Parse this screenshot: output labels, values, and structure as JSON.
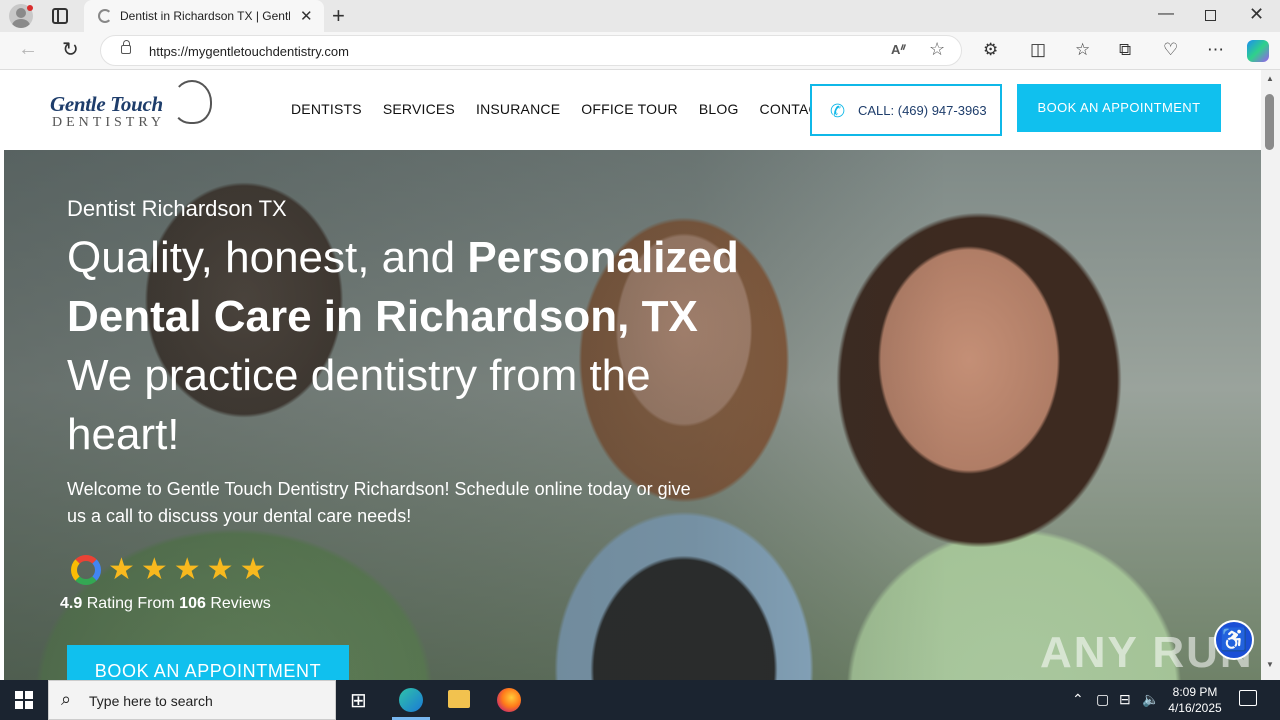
{
  "browser": {
    "tab_title": "Dentist in Richardson TX | Gentle",
    "url": "https://mygentletouchdentistry.com"
  },
  "site": {
    "logo_main": "Gentle Touch",
    "logo_sub": "DENTISTRY",
    "nav": [
      "DENTISTS",
      "SERVICES",
      "INSURANCE",
      "OFFICE TOUR",
      "BLOG",
      "CONTACT"
    ],
    "call_label": "CALL: (469) 947-3963",
    "book_label": "BOOK AN APPOINTMENT"
  },
  "hero": {
    "eyebrow": "Dentist Richardson TX",
    "headline_plain": "Quality, honest, and ",
    "headline_bold": "Personalized Dental Care in Richardson, TX",
    "headline_tail": "We practice dentistry from the heart!",
    "intro": "Welcome to Gentle Touch Dentistry Richardson! Schedule online today or give us a call to discuss your dental care needs!",
    "stars": "★★★★★",
    "rating_value": "4.9",
    "rating_mid": " Rating From ",
    "rating_count": "106",
    "rating_tail": " Reviews",
    "book_label": "BOOK AN APPOINTMENT",
    "rating_numeric": 4.9
  },
  "watermark": "ANY RUN",
  "taskbar": {
    "search_placeholder": "Type here to search",
    "time": "8:09 PM",
    "date": "4/16/2025"
  },
  "colors": {
    "accent": "#10c0ee",
    "brand": "#1e3d6b",
    "star": "#f8b91e"
  }
}
